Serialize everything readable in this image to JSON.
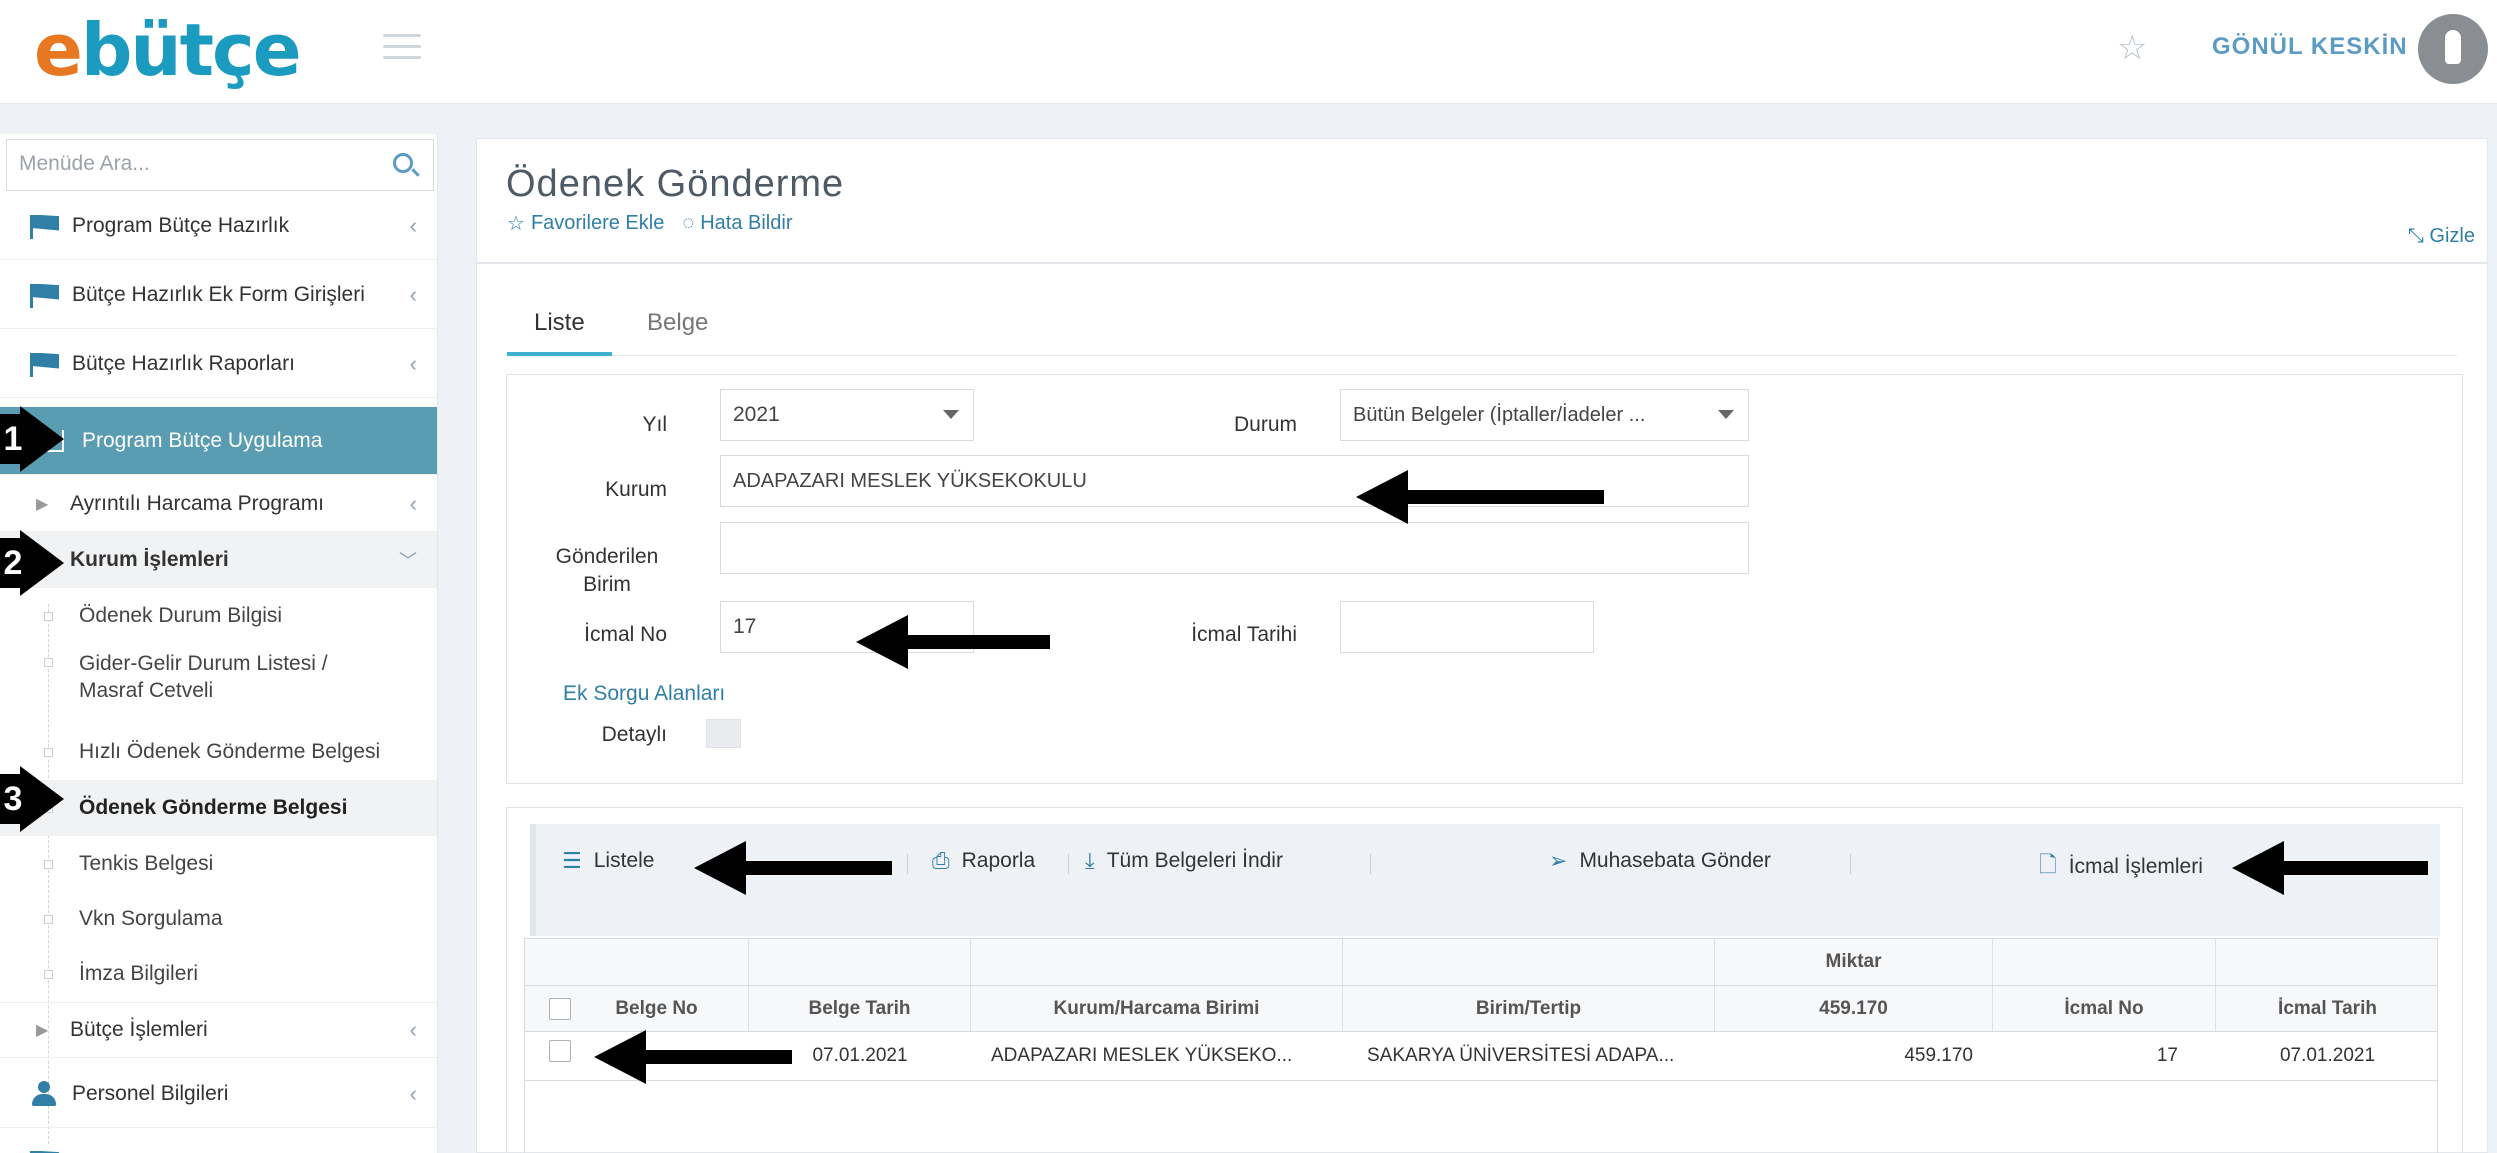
{
  "header": {
    "logo_e": "e",
    "logo_rest": "bütçe",
    "user_name": "GÖNÜL KESKİN"
  },
  "sidebar": {
    "search_placeholder": "Menüde Ara...",
    "items": [
      {
        "label": "Program Bütçe Hazırlık"
      },
      {
        "label": "Bütçe Hazırlık Ek Form Girişleri"
      },
      {
        "label": "Bütçe Hazırlık Raporları"
      },
      {
        "label": "Program Bütçe Uygulama"
      },
      {
        "label": "Ayrıntılı Harcama Programı"
      },
      {
        "label": "Kurum İşlemleri"
      },
      {
        "label": "Ödenek Durum Bilgisi"
      },
      {
        "label": "Gider-Gelir Durum Listesi / Masraf Cetveli"
      },
      {
        "label": "Hızlı Ödenek Gönderme Belgesi"
      },
      {
        "label": "Ödenek Gönderme Belgesi"
      },
      {
        "label": "Tenkis Belgesi"
      },
      {
        "label": "Vkn Sorgulama"
      },
      {
        "label": "İmza Bilgileri"
      },
      {
        "label": "Bütçe İşlemleri"
      },
      {
        "label": "Personel Bilgileri"
      }
    ],
    "steps": [
      "1",
      "2",
      "3"
    ]
  },
  "page": {
    "title": "Ödenek Gönderme",
    "add_favorites": "Favorilere Ekle",
    "report_error": "Hata Bildir",
    "hide": "Gizle"
  },
  "tabs": [
    "Liste",
    "Belge"
  ],
  "filters": {
    "yil_label": "Yıl",
    "yil_value": "2021",
    "durum_label": "Durum",
    "durum_value": "Bütün Belgeler (İptaller/İadeler ...",
    "kurum_label": "Kurum",
    "kurum_value": "ADAPAZARI MESLEK YÜKSEKOKULU",
    "gonderilen_label_1": "Gönderilen",
    "gonderilen_label_2": "Birim",
    "gonderilen_value": "",
    "icmal_no_label": "İcmal No",
    "icmal_no_value": "17",
    "icmal_tarihi_label": "İcmal Tarihi",
    "icmal_tarihi_value": "",
    "ek_sorgu": "Ek Sorgu Alanları",
    "detayli_label": "Detaylı"
  },
  "toolbar": {
    "listele": "Listele",
    "raporla": "Raporla",
    "tum_belgeleri_indir": "Tüm Belgeleri İndir",
    "muhasebata_gonder": "Muhasebata Gönder",
    "icmal_islemleri": "İcmal İşlemleri"
  },
  "table": {
    "group_header": "Miktar",
    "columns": [
      "Belge No",
      "Belge Tarih",
      "Kurum/Harcama Birimi",
      "Birim/Tertip",
      "459.170",
      "İcmal No",
      "İcmal Tarih"
    ],
    "rows": [
      [
        "",
        "07.01.2021",
        "ADAPAZARI MESLEK YÜKSEKO...",
        "SAKARYA ÜNİVERSİTESİ ADAPA...",
        "459.170",
        "17",
        "07.01.2021"
      ]
    ]
  }
}
